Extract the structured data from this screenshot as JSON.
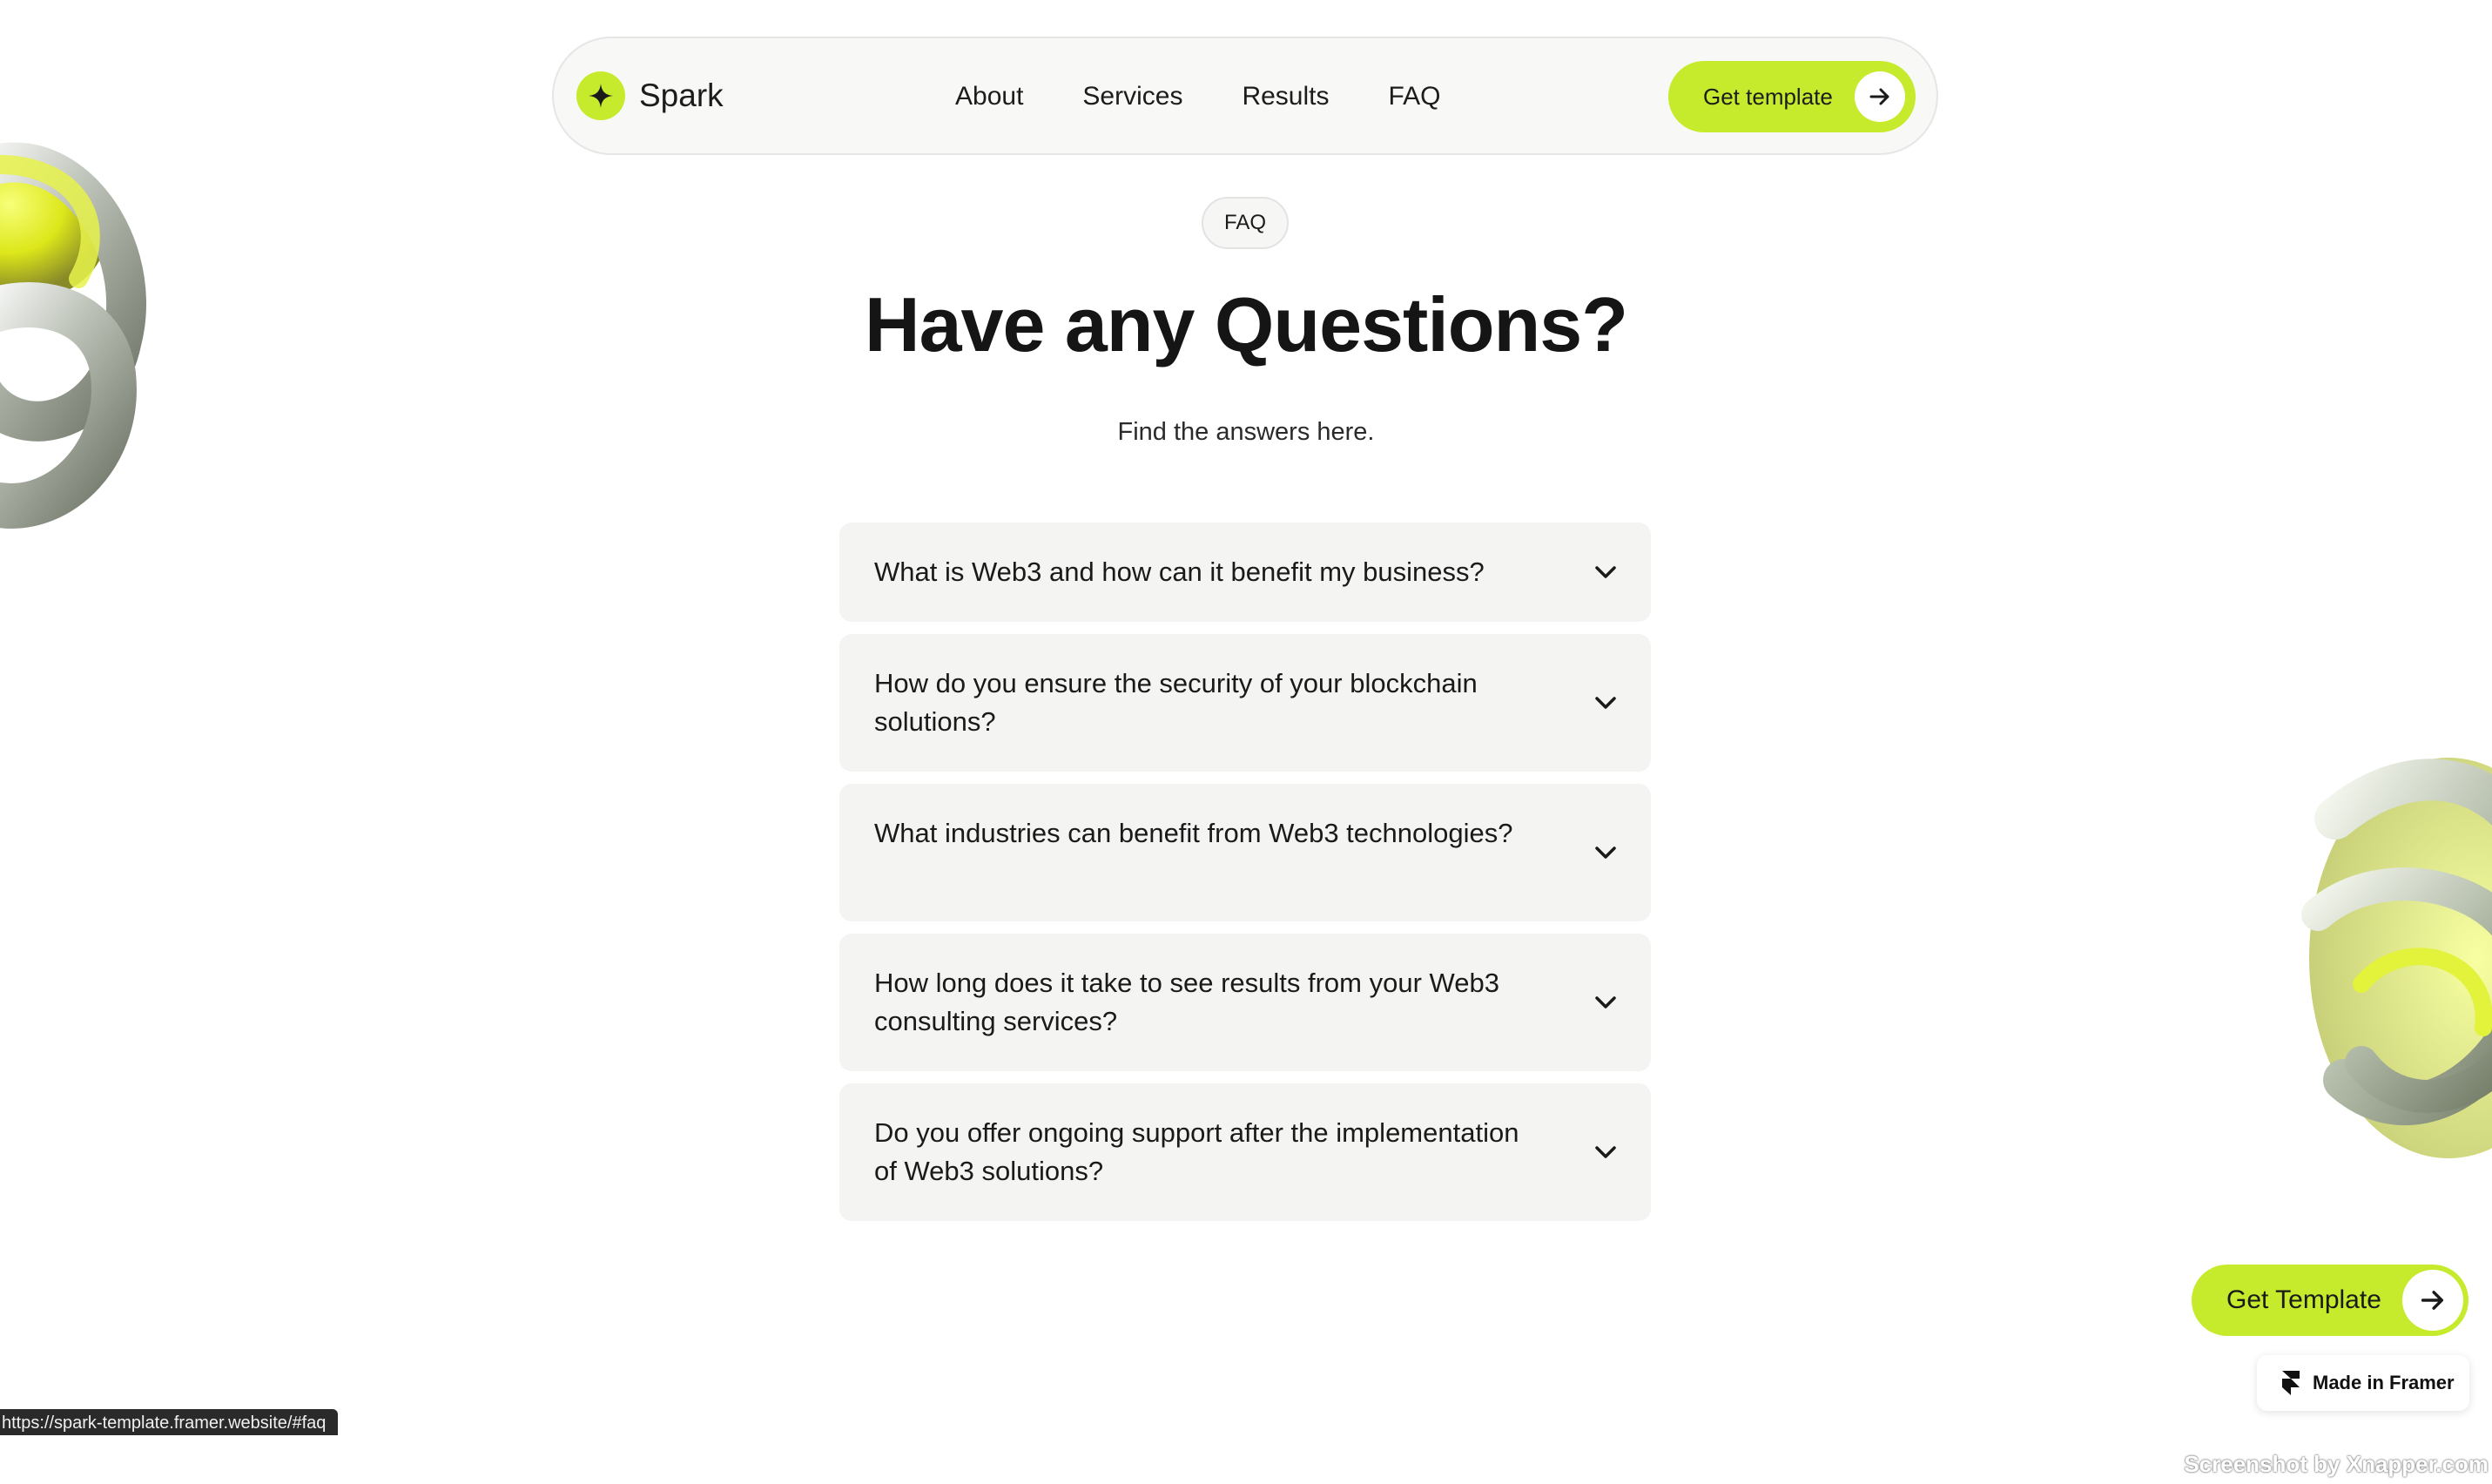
{
  "nav": {
    "brand": "Spark",
    "links": [
      "About",
      "Services",
      "Results",
      "FAQ"
    ],
    "cta_label": "Get template"
  },
  "header": {
    "tag": "FAQ",
    "title": "Have any Questions?",
    "subtitle": "Find the answers here."
  },
  "faq": {
    "items": [
      {
        "question": "What is Web3 and how can it benefit my business?",
        "expanded": false
      },
      {
        "question": "How do you ensure the security of your blockchain solutions?",
        "expanded": false
      },
      {
        "question": "What industries can benefit from Web3 technologies?",
        "expanded": false
      },
      {
        "question": "How long does it take to see results from your Web3 consulting services?",
        "expanded": false
      },
      {
        "question": "Do you offer ongoing support after the implementation of Web3 solutions?",
        "expanded": false
      }
    ]
  },
  "floating": {
    "cta_label": "Get Template",
    "badge_label": "Made in Framer"
  },
  "status_bar": {
    "url": "https://spark-template.framer.website/#faq"
  },
  "watermark": "Screenshot by Xnapper.com",
  "icons": {
    "brand": "sparkle-icon",
    "cta": "arrow-right-icon",
    "faq_toggle": "chevron-down-icon",
    "badge": "framer-logo-icon"
  },
  "colors": {
    "accent": "#c6ea2c",
    "card": "#f4f4f2",
    "text": "#1a1a1a"
  }
}
